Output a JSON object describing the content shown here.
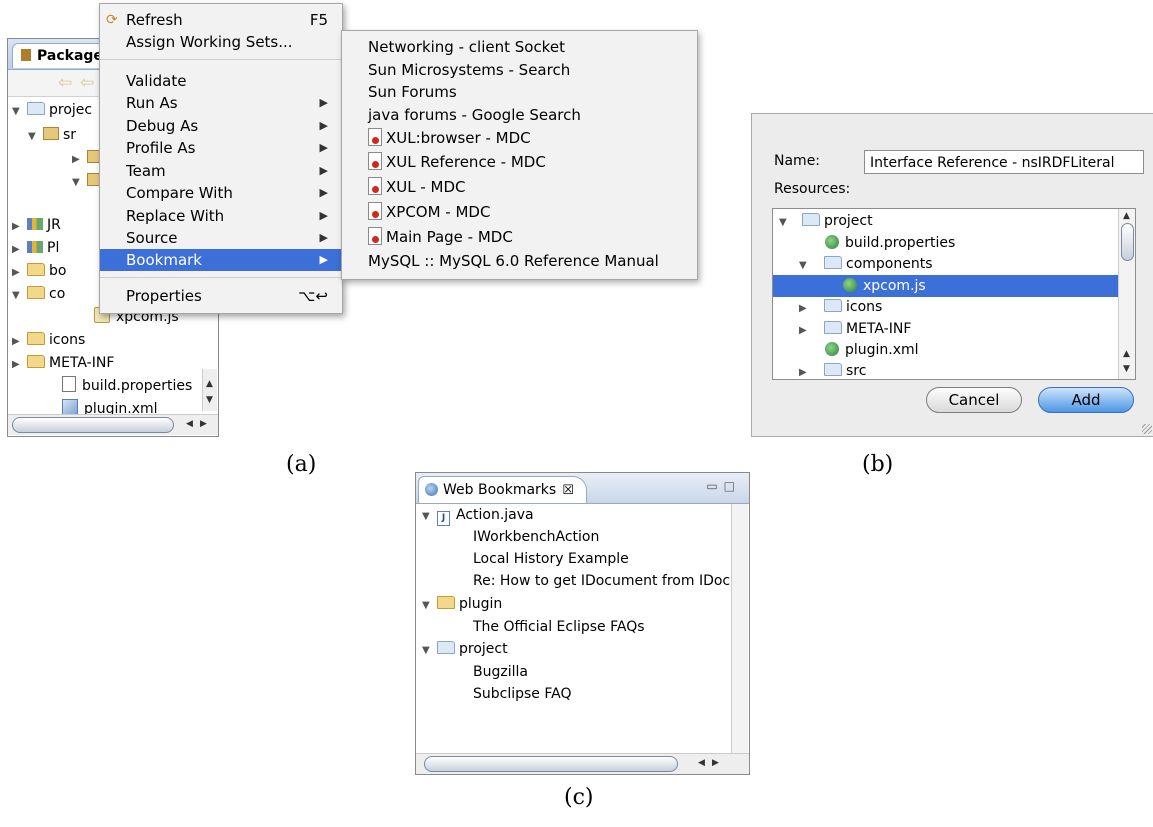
{
  "panel_a": {
    "caption": "(a)",
    "view_tab": "Package",
    "tree": [
      "projec",
      "sr",
      "JR",
      "Pl",
      "bo",
      "co",
      "xpcom.js",
      "icons",
      "META-INF",
      "build.properties",
      "plugin.xml"
    ],
    "context_menu": {
      "items": [
        {
          "label": "Refresh",
          "shortcut": "F5"
        },
        {
          "label": "Assign Working Sets..."
        },
        {
          "label": "Validate"
        },
        {
          "label": "Run As"
        },
        {
          "label": "Debug As"
        },
        {
          "label": "Profile As"
        },
        {
          "label": "Team"
        },
        {
          "label": "Compare With"
        },
        {
          "label": "Replace With"
        },
        {
          "label": "Source"
        },
        {
          "label": "Bookmark"
        },
        {
          "label": "Properties",
          "shortcut": "⌥↩"
        }
      ],
      "selected": "Bookmark"
    },
    "bookmark_submenu": [
      "Networking - client Socket",
      "Sun Microsystems - Search",
      "Sun Forums",
      "java forums - Google Search",
      "XUL:browser - MDC",
      "XUL Reference - MDC",
      "XUL - MDC",
      "XPCOM - MDC",
      "Main Page - MDC",
      "MySQL :: MySQL 6.0 Reference Manual"
    ]
  },
  "panel_b": {
    "caption": "(b)",
    "name_label": "Name:",
    "name_value": "Interface Reference - nsIRDFLiteral",
    "resources_label": "Resources:",
    "tree": [
      "project",
      "build.properties",
      "components",
      "xpcom.js",
      "icons",
      "META-INF",
      "plugin.xml",
      "src"
    ],
    "selected": "xpcom.js",
    "cancel_label": "Cancel",
    "add_label": "Add"
  },
  "panel_c": {
    "caption": "(c)",
    "view_tab": "Web Bookmarks",
    "tree": [
      "Action.java",
      "IWorkbenchAction",
      "Local History Example",
      "Re: How to get IDocument from IDocu",
      "plugin",
      "The Official Eclipse FAQs",
      "project",
      "Bugzilla",
      "Subclipse FAQ"
    ]
  },
  "colors": {
    "selection": "#3d6fd8",
    "menu_bg": "#f2f2f2",
    "folder": "#f3d88a"
  }
}
